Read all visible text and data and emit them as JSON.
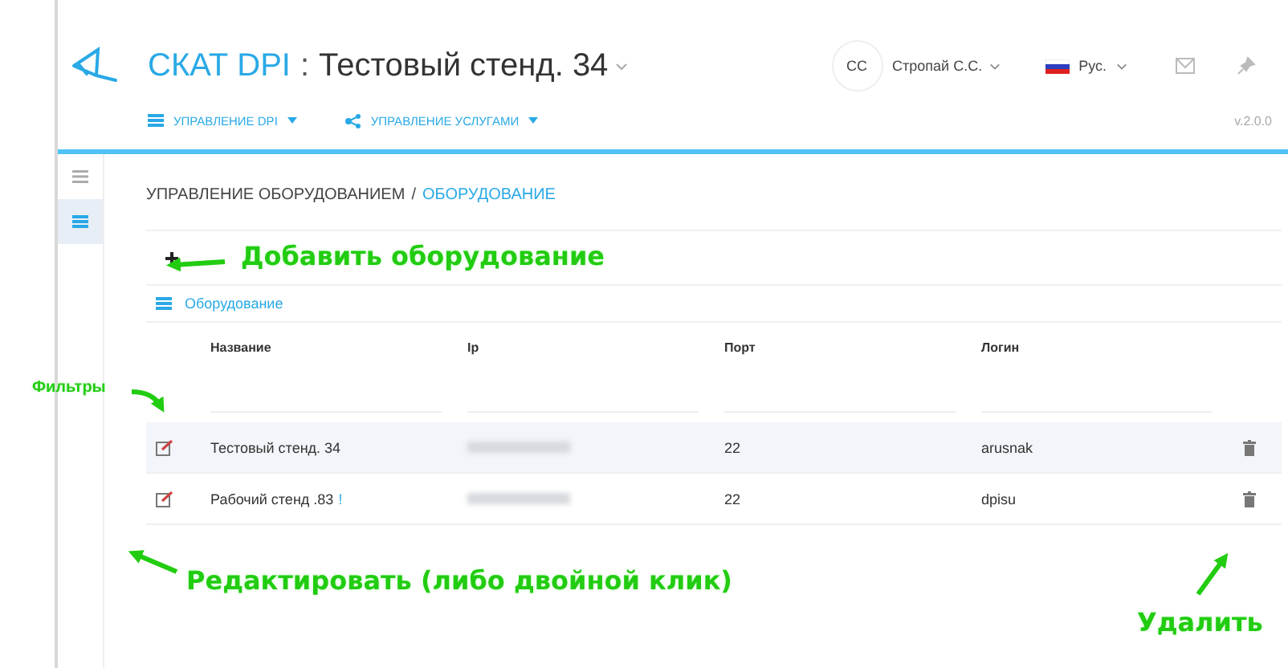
{
  "header": {
    "brand": "СКАТ DPI",
    "separator": ":",
    "title": "Тестовый стенд. 34",
    "user_initials": "CC",
    "user_name": "Стропай С.С.",
    "language": "Рус.",
    "version": "v.2.0.0"
  },
  "nav": [
    {
      "label": "УПРАВЛЕНИЕ DPI"
    },
    {
      "label": "УПРАВЛЕНИЕ УСЛУГАМИ"
    }
  ],
  "sidebar": [
    {
      "selected": false
    },
    {
      "selected": true
    }
  ],
  "breadcrumb": [
    "УПРАВЛЕНИЕ ОБОРУДОВАНИЕМ",
    "/",
    "ОБОРУДОВАНИЕ"
  ],
  "panel_title": "Оборудование",
  "table": {
    "columns": [
      "Название",
      "Ip",
      "Порт",
      "Логин"
    ],
    "rows": [
      {
        "name": "Тестовый стенд. 34",
        "ip_redacted": true,
        "port": "22",
        "login": "arusnak",
        "selected": true
      },
      {
        "name": "Рабочий стенд .83",
        "mark": "!",
        "ip_redacted": true,
        "port": "22",
        "login": "dpisu",
        "selected": false
      }
    ]
  },
  "annotations": [
    {
      "text": "Добавить оборудование"
    },
    {
      "text": "Фильтры"
    },
    {
      "text": "Редактировать (либо двойной клик)"
    },
    {
      "text": "Удалить"
    }
  ]
}
